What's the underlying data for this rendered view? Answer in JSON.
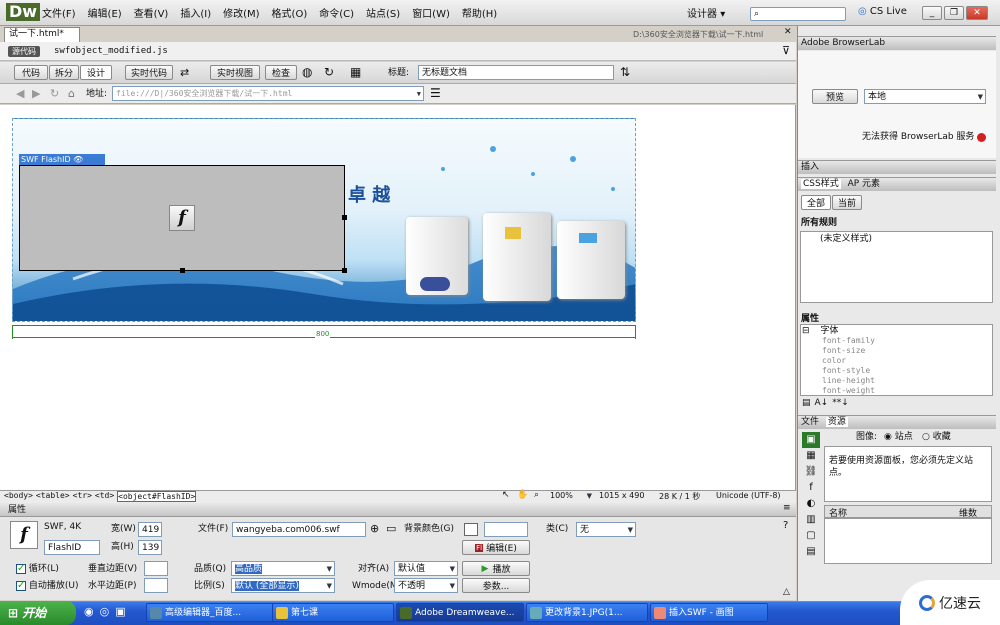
{
  "menubar": {
    "logo": "Dw",
    "items": [
      "文件(F)",
      "编辑(E)",
      "查看(V)",
      "插入(I)",
      "修改(M)",
      "格式(O)",
      "命令(C)",
      "站点(S)",
      "窗口(W)",
      "帮助(H)"
    ],
    "workspace": "设计器",
    "cslive": "CS Live"
  },
  "doc": {
    "tab": "试一下.html*",
    "path": "D:\\360安全浏览器下载\\试一下.html",
    "source_btn": "源代码",
    "related_file": "swfobject_modified.js"
  },
  "toolbar": {
    "code": "代码",
    "split": "拆分",
    "design": "设计",
    "live_code": "实时代码",
    "live_view": "实时视图",
    "inspect": "检查",
    "title_label": "标题:",
    "title_value": "无标题文档"
  },
  "address": {
    "label": "地址:",
    "value": "file:///D|/360安全浏览器下载/试一下.html"
  },
  "canvas": {
    "swf_tag": "SWF  FlashID",
    "banner_text": "卓 越",
    "ruler_width": "800"
  },
  "statusbar": {
    "tags": [
      "<body>",
      "<table>",
      "<tr>",
      "<td>",
      "<object#FlashID>"
    ],
    "zoom": "100%",
    "size": "1015 x 490",
    "filesize": "28 K / 1 秒",
    "encoding": "Unicode (UTF-8)"
  },
  "props": {
    "title": "属性",
    "swf_info": "SWF, 4K",
    "name": "FlashID",
    "width_label": "宽(W)",
    "width": "419",
    "height_label": "高(H)",
    "height": "139",
    "file_label": "文件(F)",
    "file": "wangyeba.com006.swf",
    "bg_label": "背景颜色(G)",
    "edit": "编辑(E)",
    "class_label": "类(C)",
    "class_value": "无",
    "loop": "循环(L)",
    "autoplay": "自动播放(U)",
    "vspace": "垂直边距(V)",
    "hspace": "水平边距(P)",
    "quality_label": "品质(Q)",
    "quality": "高品质",
    "scale_label": "比例(S)",
    "scale": "默认 (全部显示)",
    "align_label": "对齐(A)",
    "align": "默认值",
    "wmode_label": "Wmode(M)",
    "wmode": "不透明",
    "play": "播放",
    "params": "参数..."
  },
  "panels": {
    "browserlab": "Adobe BrowserLab",
    "preview": "预览",
    "local": "本地",
    "browserlab_msg": "无法获得 BrowserLab 服务",
    "insert": "插入",
    "css_tab": "CSS样式",
    "ap_tab": "AP 元素",
    "all": "全部",
    "current": "当前",
    "all_rules": "所有规则",
    "undefined_style": "(未定义样式)",
    "attrs": "属性",
    "font_group": "字体",
    "font_props": [
      "font-family",
      "font-size",
      "color",
      "font-style",
      "line-height",
      "font-weight"
    ],
    "files_tab": "文件",
    "assets_tab": "资源",
    "image_label": "图像:",
    "site": "站点",
    "favorites": "收藏",
    "assets_msg": "若要使用资源面板，您必须先定义站点。",
    "col_name": "名称",
    "col_dim": "维数"
  },
  "taskbar": {
    "start": "开始",
    "tasks": [
      "高级编辑器_百度...",
      "第七课",
      "Adobe Dreamweave...",
      "更改背景1.JPG(1...",
      "插入SWF - 画图"
    ]
  },
  "watermark": "亿速云"
}
